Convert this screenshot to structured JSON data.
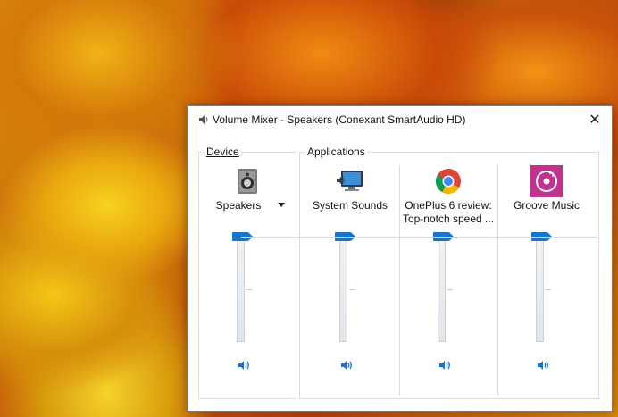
{
  "window": {
    "title": "Volume Mixer - Speakers (Conexant SmartAudio HD)",
    "close_label": "✕"
  },
  "groups": {
    "device_label": "Device",
    "applications_label": "Applications"
  },
  "channels": [
    {
      "name": "Speakers",
      "icon": "speaker-device-icon",
      "volume_percent": 100,
      "muted": false
    },
    {
      "name": "System Sounds",
      "icon": "system-sounds-icon",
      "volume_percent": 100,
      "muted": false
    },
    {
      "name_line1": "OnePlus 6 review:",
      "name_line2": "Top-notch speed ...",
      "icon": "chrome-icon",
      "volume_percent": 100,
      "muted": false
    },
    {
      "name": "Groove Music",
      "icon": "groove-music-icon",
      "volume_percent": 100,
      "muted": false
    }
  ],
  "colors": {
    "accent": "#1b73c9",
    "groove": "#c2318e"
  }
}
